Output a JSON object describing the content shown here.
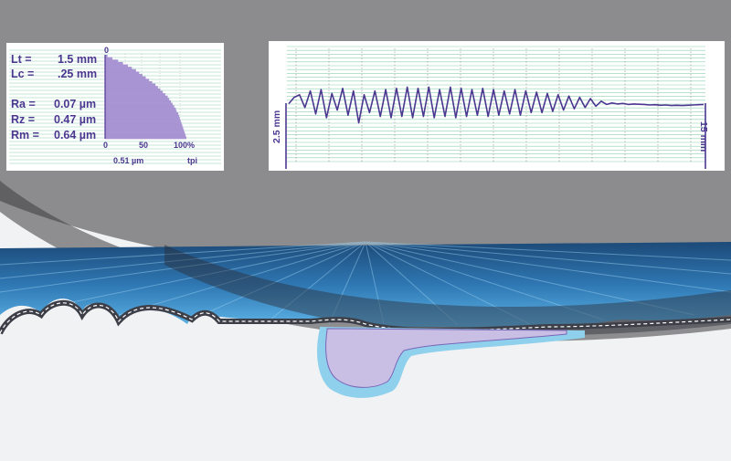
{
  "colors": {
    "background": "#8c8c8e",
    "accent": "#4b3790",
    "bar_fill": "#a894d2",
    "grid_line": "#8ed0b0"
  },
  "stats": [
    {
      "label": "Lt =",
      "value": "1.5 mm"
    },
    {
      "label": "Lc =",
      "value": ".25 mm"
    },
    {
      "label": "Ra =",
      "value": "0.07 µm"
    },
    {
      "label": "Rz =",
      "value": "0.47 µm"
    },
    {
      "label": "Rm =",
      "value": "0.64 µm"
    }
  ],
  "bearing_chart": {
    "top_tick": "0",
    "x_ticks": [
      "0",
      "50",
      "100%"
    ],
    "bottom_left_label": "0.51 µm",
    "bottom_right_label": "tpi"
  },
  "profile_chart": {
    "left_label": "2.5 mm",
    "right_label": "15 mm"
  },
  "chart_data": [
    {
      "type": "bar",
      "title": "",
      "orientation": "horizontal",
      "xlabel": "",
      "ylabel": "",
      "xlim": [
        0,
        100
      ],
      "x_ticks": [
        0,
        50,
        100
      ],
      "values": [
        3,
        9,
        16,
        22,
        28,
        33,
        38,
        42,
        46,
        50,
        54,
        58,
        62,
        65,
        68,
        71,
        74,
        77,
        79,
        81,
        83,
        85,
        87,
        88,
        90,
        91,
        92,
        93,
        94,
        95,
        96,
        97,
        98,
        99,
        100
      ]
    },
    {
      "type": "line",
      "title": "",
      "xlabel": "",
      "ylabel": "",
      "grid": true,
      "ylim": [
        -1,
        1
      ],
      "series": [
        {
          "values": [
            0.05,
            0.3,
            0.4,
            -0.1,
            0.55,
            -0.35,
            0.6,
            -0.5,
            0.45,
            -0.2,
            0.65,
            -0.4,
            0.55,
            -0.7,
            0.4,
            -0.3,
            0.55,
            -0.45,
            0.6,
            -0.5,
            0.65,
            -0.45,
            0.7,
            -0.5,
            0.65,
            -0.45,
            0.7,
            -0.5,
            0.6,
            -0.45,
            0.7,
            -0.5,
            0.65,
            -0.45,
            0.6,
            -0.4,
            0.65,
            -0.45,
            0.6,
            -0.4,
            0.55,
            -0.35,
            0.6,
            -0.4,
            0.55,
            -0.3,
            0.5,
            -0.3,
            0.45,
            -0.25,
            0.4,
            -0.2,
            0.35,
            -0.15,
            0.3,
            -0.1,
            0.25,
            -0.05,
            0.15,
            0.02,
            0.08,
            0.04,
            0.06,
            0.02,
            0.04,
            0.03,
            0.02,
            0.0,
            0.01,
            -0.01,
            0.0,
            -0.02,
            -0.01,
            -0.02,
            -0.01,
            0.0,
            0.01,
            0.02
          ]
        }
      ]
    }
  ]
}
